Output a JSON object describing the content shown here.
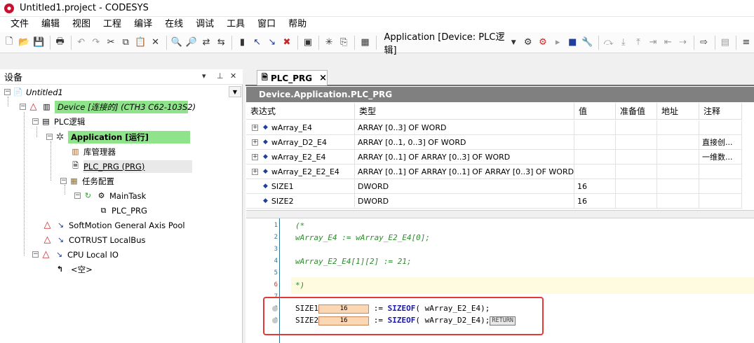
{
  "window": {
    "title": "Untitled1.project - CODESYS"
  },
  "menu": [
    "文件",
    "编辑",
    "视图",
    "工程",
    "编译",
    "在线",
    "调试",
    "工具",
    "窗口",
    "帮助"
  ],
  "toolbar": {
    "application_selector": "Application [Device: PLC逻辑]"
  },
  "devices": {
    "header": "设备",
    "tree": {
      "project": "Untitled1",
      "device": "Device [连接的] (CTH3 C62-103S2)",
      "plc_logic": "PLC逻辑",
      "application": "Application [运行]",
      "library_manager": "库管理器",
      "plc_prg": "PLC_PRG (PRG)",
      "task_config": "任务配置",
      "main_task": "MainTask",
      "main_task_prg": "PLC_PRG",
      "softmotion": "SoftMotion General Axis Pool",
      "cotrust": "COTRUST LocalBus",
      "cpu_local_io": "CPU Local IO",
      "empty": "<空>"
    }
  },
  "editor": {
    "tab_label": "PLC_PRG",
    "path": "Device.Application.PLC_PRG",
    "columns": [
      "表达式",
      "类型",
      "值",
      "准备值",
      "地址",
      "注释"
    ],
    "rows": [
      {
        "expr": "wArray_E4",
        "type": "ARRAY [0..3] OF WORD",
        "value": "",
        "comment": "",
        "expandable": true
      },
      {
        "expr": "wArray_D2_E4",
        "type": "ARRAY [0..1, 0..3] OF WORD",
        "value": "",
        "comment": "直接创...",
        "expandable": true
      },
      {
        "expr": "wArray_E2_E4",
        "type": "ARRAY [0..1] OF ARRAY [0..3] OF WORD",
        "value": "",
        "comment": "一维数...",
        "expandable": true
      },
      {
        "expr": "wArray_E2_E2_E4",
        "type": "ARRAY [0..1] OF ARRAY [0..1] OF ARRAY [0..3] OF WORD",
        "value": "",
        "comment": "",
        "expandable": true
      },
      {
        "expr": "SIZE1",
        "type": "DWORD",
        "value": "16",
        "comment": "",
        "expandable": false
      },
      {
        "expr": "SIZE2",
        "type": "DWORD",
        "value": "16",
        "comment": "",
        "expandable": false
      }
    ],
    "code": {
      "line_numbers": [
        "1",
        "2",
        "3",
        "4",
        "5",
        "6",
        "7",
        "8",
        "9"
      ],
      "l1": "(*",
      "l2": "wArray_E4 := wArray_E2_E4[0];",
      "l4": "wArray_E2_E4[1][2] := 21;",
      "l6": "*)",
      "l8": {
        "var": "SIZE1",
        "monitor": "16",
        "assign": " := ",
        "func": "SIZEOF",
        "arg": "( wArray_E2_E4);"
      },
      "l9": {
        "var": "SIZE2",
        "monitor": "16",
        "assign": " := ",
        "func": "SIZEOF",
        "arg": "( wArray_D2_E4);",
        "return_label": "RETURN"
      }
    }
  },
  "colors": {
    "active_green": "#8fe38a",
    "highlight_box": "#e53935",
    "monitor_fill": "#fbd7b4",
    "path_bar": "#808080"
  }
}
